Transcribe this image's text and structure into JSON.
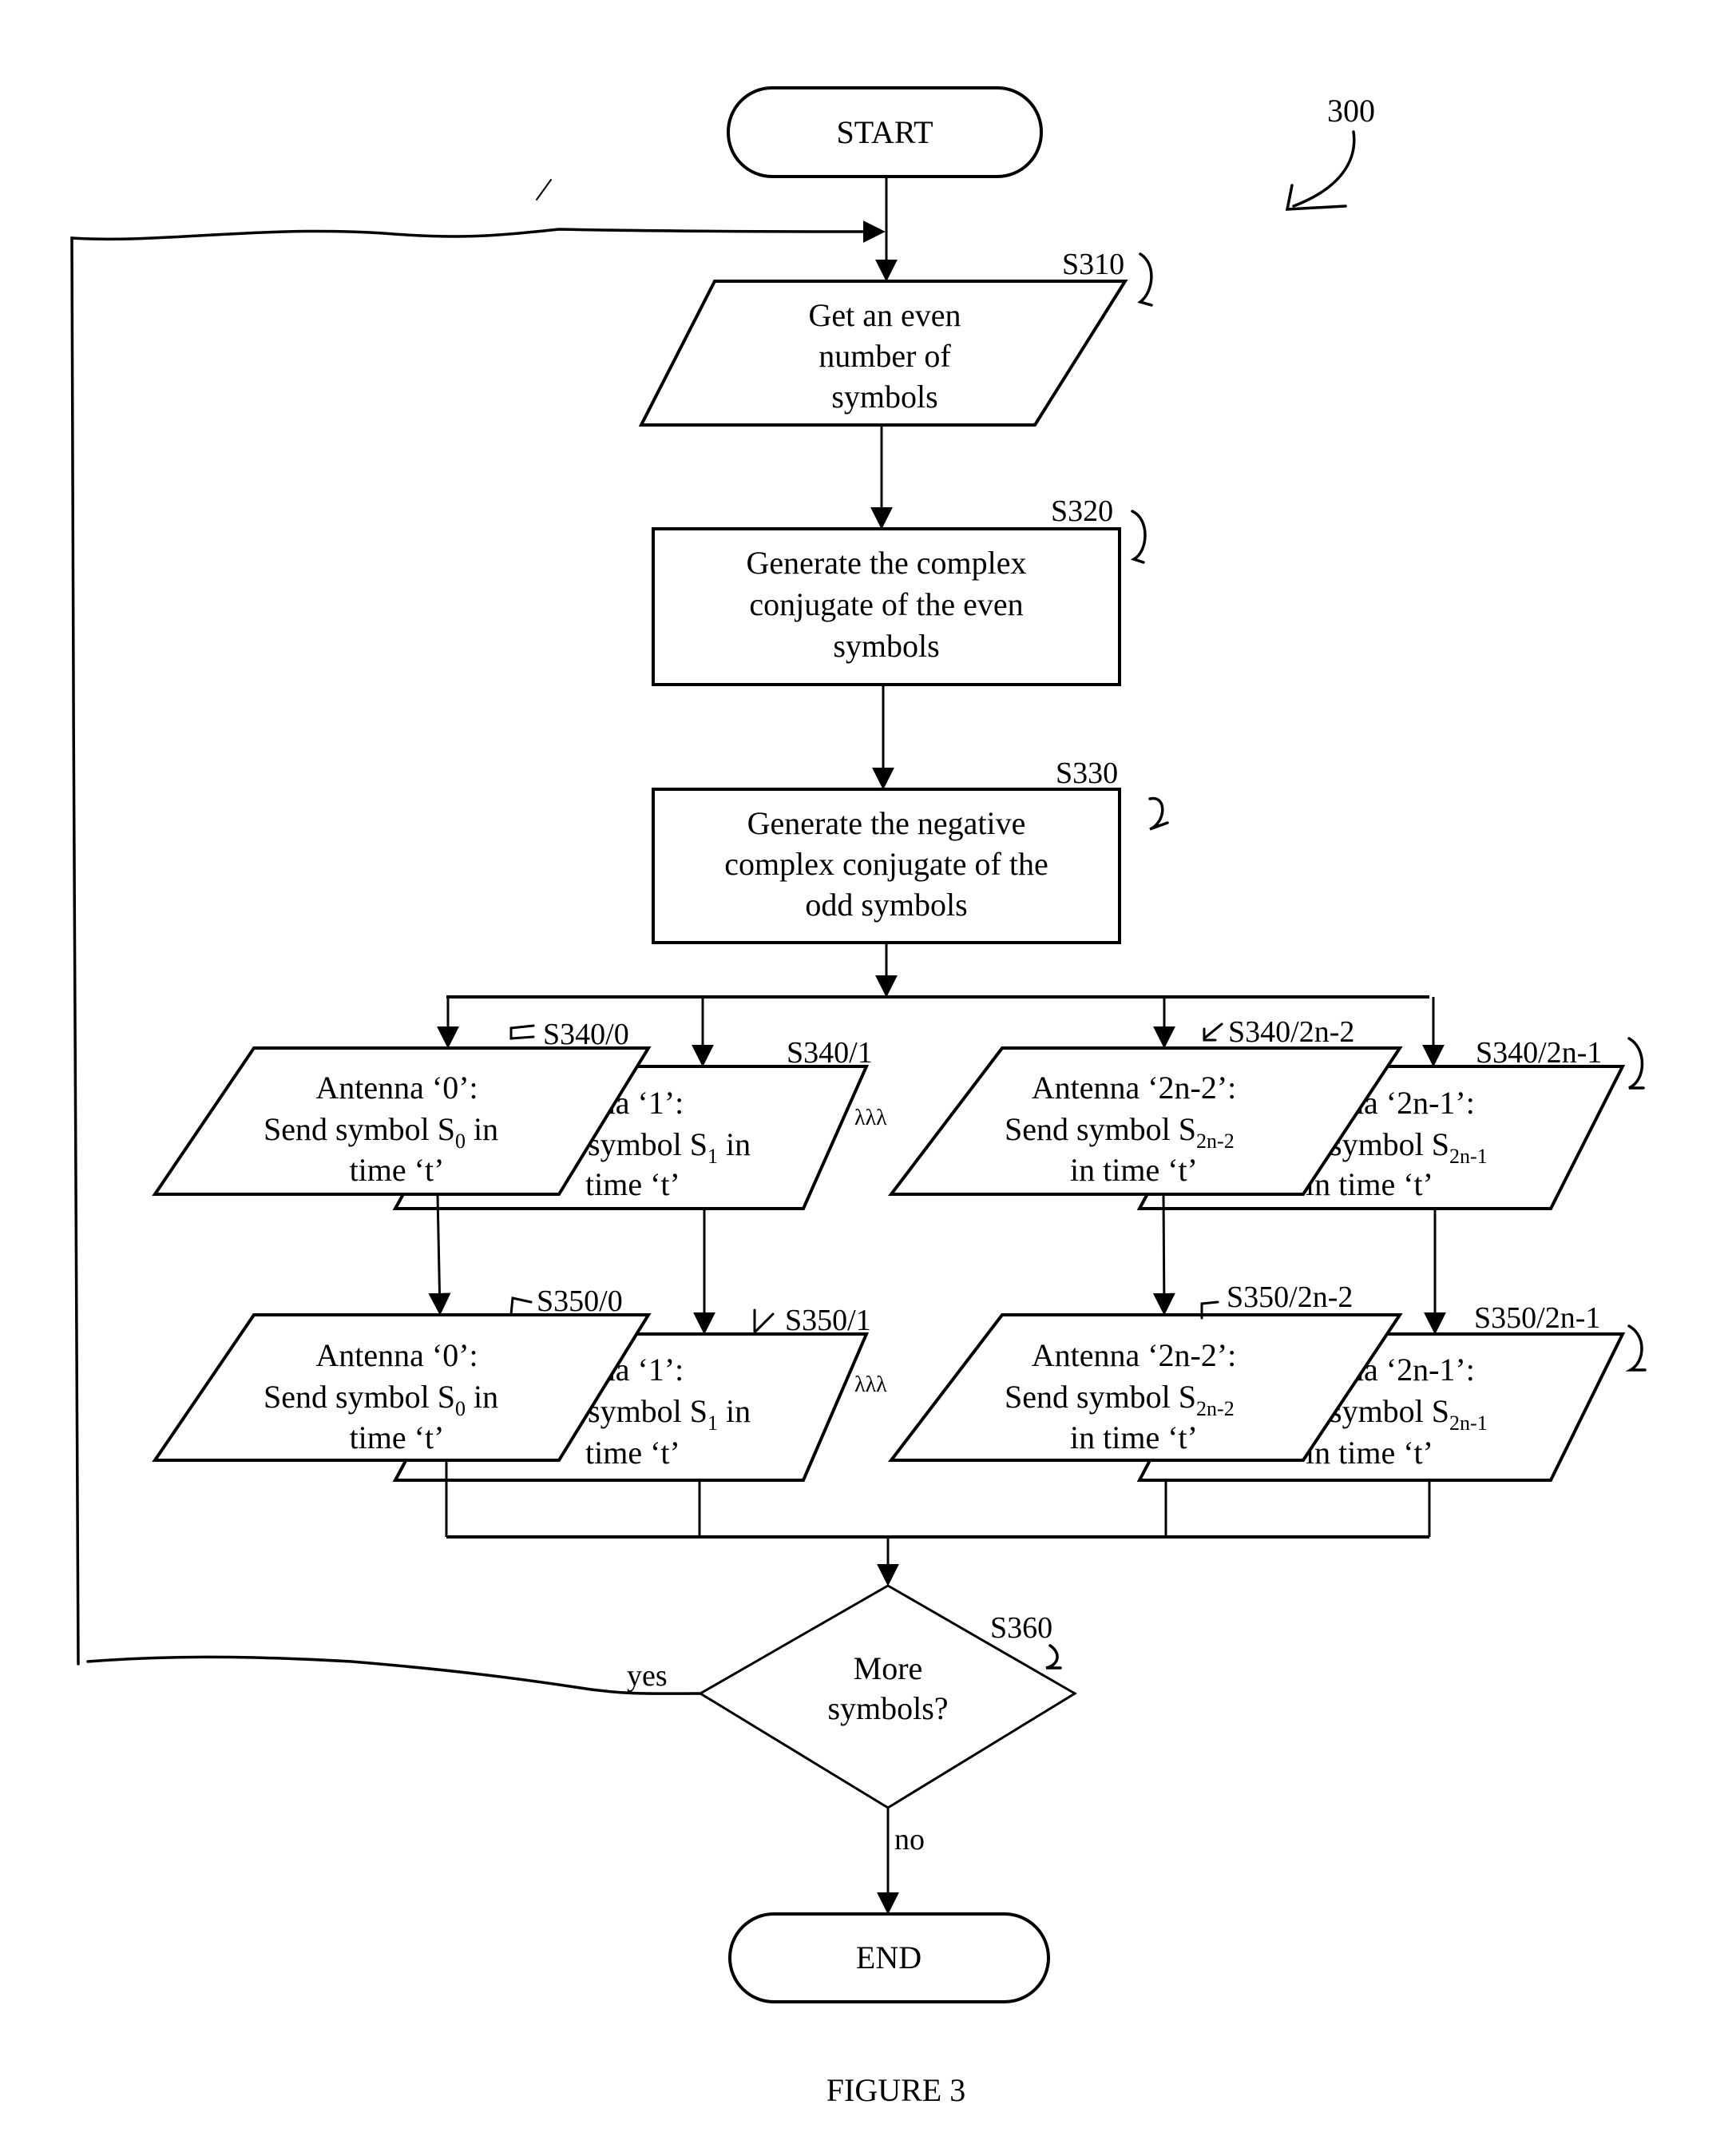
{
  "figure": {
    "reference_number": "300",
    "caption": "FIGURE 3"
  },
  "nodes": {
    "start": {
      "text": "START"
    },
    "end": {
      "text": "END"
    },
    "s310": {
      "label": "S310",
      "lines": [
        "Get an even",
        "number of",
        "symbols"
      ]
    },
    "s320": {
      "label": "S320",
      "lines": [
        "Generate the complex",
        "conjugate of the even",
        "symbols"
      ]
    },
    "s330": {
      "label": "S330",
      "lines": [
        "Generate the negative",
        "complex conjugate of the",
        "odd symbols"
      ]
    },
    "s340": [
      {
        "label": "S340/0",
        "lines": [
          "Antenna ‘0’:",
          "Send symbol S",
          "in",
          "time ‘t’"
        ],
        "sub": "0"
      },
      {
        "label": "S340/1",
        "lines": [
          "enna ‘1’:",
          "symbol S",
          "in",
          "time ‘t’"
        ],
        "sub": "1"
      },
      {
        "label": "S340/2n-2",
        "lines": [
          "Antenna ‘2n-2’:",
          "Send symbol S",
          "",
          "in time ‘t’"
        ],
        "sub": "2n-2"
      },
      {
        "label": "S340/2n-1",
        "lines": [
          "na ‘2n-1’:",
          "symbol S",
          "",
          "in time ‘t’"
        ],
        "sub": "2n-1"
      }
    ],
    "s350": [
      {
        "label": "S350/0",
        "lines": [
          "Antenna ‘0’:",
          "Send symbol S",
          "in",
          "time ‘t’"
        ],
        "sub": "0"
      },
      {
        "label": "S350/1",
        "lines": [
          "enna ‘1’:",
          "symbol S",
          "in",
          "time ‘t’"
        ],
        "sub": "1"
      },
      {
        "label": "S350/2n-2",
        "lines": [
          "Antenna ‘2n-2’:",
          "Send symbol S",
          "",
          "in time ‘t’"
        ],
        "sub": "2n-2"
      },
      {
        "label": "S350/2n-1",
        "lines": [
          "na ‘2n-1’:",
          "symbol S",
          "",
          "in time ‘t’"
        ],
        "sub": "2n-1"
      }
    ],
    "ellipsis": "λλλ",
    "s360": {
      "label": "S360",
      "lines": [
        "More",
        "symbols?"
      ],
      "yes": "yes",
      "no": "no"
    }
  }
}
